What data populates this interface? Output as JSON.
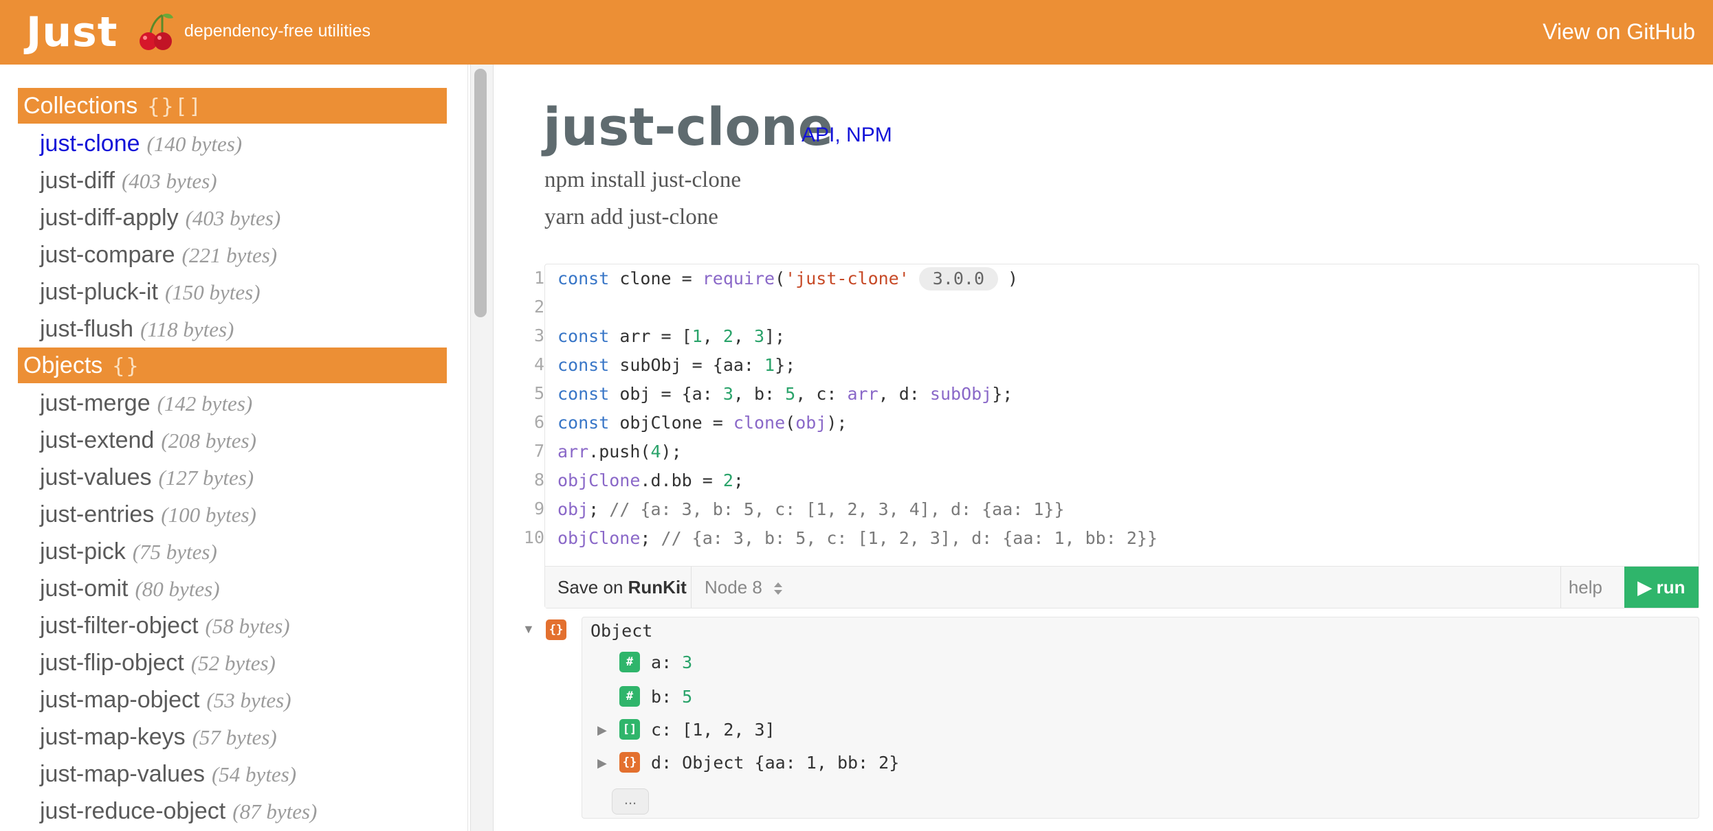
{
  "header": {
    "brand": "Just",
    "tagline": "dependency-free utilities",
    "github_link": "View on GitHub",
    "logo_icon": "cherry-icon",
    "color": "#ec8f35"
  },
  "sidebar": {
    "sections": [
      {
        "title": "Collections",
        "symbol": "{}[]",
        "items": [
          {
            "name": "just-clone",
            "size": "(140 bytes)",
            "active": true
          },
          {
            "name": "just-diff",
            "size": "(403 bytes)"
          },
          {
            "name": "just-diff-apply",
            "size": "(403 bytes)"
          },
          {
            "name": "just-compare",
            "size": "(221 bytes)"
          },
          {
            "name": "just-pluck-it",
            "size": "(150 bytes)"
          },
          {
            "name": "just-flush",
            "size": "(118 bytes)"
          }
        ]
      },
      {
        "title": "Objects",
        "symbol": "{}",
        "items": [
          {
            "name": "just-merge",
            "size": "(142 bytes)"
          },
          {
            "name": "just-extend",
            "size": "(208 bytes)"
          },
          {
            "name": "just-values",
            "size": "(127 bytes)"
          },
          {
            "name": "just-entries",
            "size": "(100 bytes)"
          },
          {
            "name": "just-pick",
            "size": "(75 bytes)"
          },
          {
            "name": "just-omit",
            "size": "(80 bytes)"
          },
          {
            "name": "just-filter-object",
            "size": "(58 bytes)"
          },
          {
            "name": "just-flip-object",
            "size": "(52 bytes)"
          },
          {
            "name": "just-map-object",
            "size": "(53 bytes)"
          },
          {
            "name": "just-map-keys",
            "size": "(57 bytes)"
          },
          {
            "name": "just-map-values",
            "size": "(54 bytes)"
          },
          {
            "name": "just-reduce-object",
            "size": "(87 bytes)"
          }
        ]
      }
    ]
  },
  "main": {
    "title": "just-clone",
    "links": [
      "API",
      "NPM"
    ],
    "link_separator": ",",
    "install_npm": "npm install just-clone",
    "install_yarn": "yarn add just-clone"
  },
  "editor": {
    "line_numbers": [
      "1",
      "2",
      "3",
      "4",
      "5",
      "6",
      "7",
      "8",
      "9",
      "10"
    ],
    "version_badge": "3.0.0",
    "save_prefix": "Save on ",
    "save_brand": "RunKit",
    "node_label": "Node 8",
    "node_icon": "updown-chevron-icon",
    "help_label": "help",
    "run_label": "▶ run"
  },
  "output": {
    "root_label": "Object",
    "props": [
      {
        "key": "a",
        "value": "3",
        "type": "number"
      },
      {
        "key": "b",
        "value": "5",
        "type": "number"
      },
      {
        "key": "c",
        "value": "[1, 2, 3]",
        "type": "array"
      },
      {
        "key": "d",
        "value": "Object {aa: 1, bb: 2}",
        "type": "object"
      }
    ],
    "more_label": "..."
  }
}
